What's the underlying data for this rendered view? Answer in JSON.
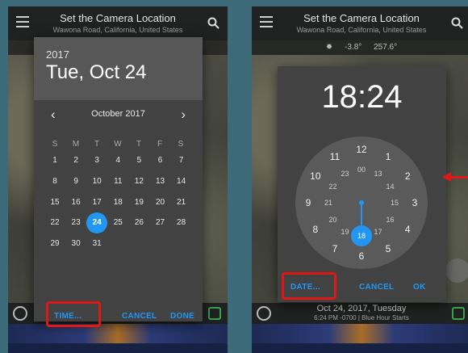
{
  "header": {
    "title": "Set the Camera Location",
    "subtitle": "Wawona Road, California, United States"
  },
  "sun_row": {
    "altitude": "-3.8°",
    "azimuth": "257.6°"
  },
  "bottom_bar": {
    "date": "Oct 24, 2017, Tuesday",
    "time": "6:24 PM -0700 | Blue Hour Starts"
  },
  "date_dialog": {
    "year": "2017",
    "selected_date": "Tue, Oct 24",
    "month_label": "October 2017",
    "prev_icon": "‹",
    "next_icon": "›",
    "weekdays": [
      "S",
      "M",
      "T",
      "W",
      "T",
      "F",
      "S"
    ],
    "weeks": [
      [
        "1",
        "2",
        "3",
        "4",
        "5",
        "6",
        "7"
      ],
      [
        "8",
        "9",
        "10",
        "11",
        "12",
        "13",
        "14"
      ],
      [
        "15",
        "16",
        "17",
        "18",
        "19",
        "20",
        "21"
      ],
      [
        "22",
        "23",
        "24",
        "25",
        "26",
        "27",
        "28"
      ],
      [
        "29",
        "30",
        "31",
        "",
        "",
        "",
        ""
      ]
    ],
    "selected_day": "24",
    "time_button": "TIME...",
    "cancel_button": "CANCEL",
    "done_button": "DONE"
  },
  "time_dialog": {
    "hours": "18",
    "separator": ":",
    "minutes": "24",
    "outer_numbers": [
      "12",
      "1",
      "2",
      "3",
      "4",
      "5",
      "6",
      "7",
      "8",
      "9",
      "10",
      "11"
    ],
    "inner_numbers": [
      "00",
      "13",
      "14",
      "15",
      "16",
      "17",
      "18",
      "19",
      "20",
      "21",
      "22",
      "23"
    ],
    "selected_hour": "18",
    "date_button": "DATE...",
    "cancel_button": "CANCEL",
    "ok_button": "OK"
  },
  "colors": {
    "accent": "#2196f3",
    "highlight": "#e01717",
    "dialog_bg": "#424242"
  }
}
